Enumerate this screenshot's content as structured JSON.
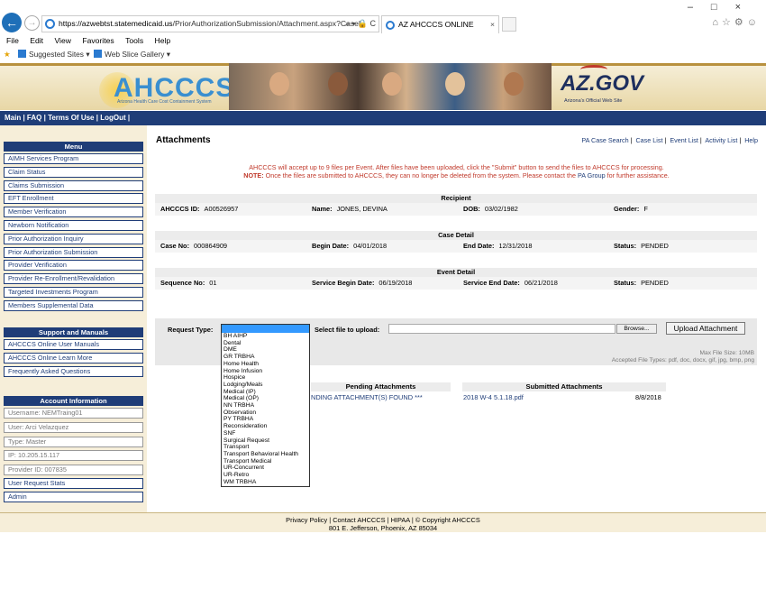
{
  "browser": {
    "url_host": "https://azwebtst.statemedicaid.us",
    "url_path": "/PriorAuthorizationSubmission/Attachment.aspx?Casel",
    "url_tools": "⌕ ▾ 🔒 C",
    "tab_title": "AZ AHCCCS ONLINE",
    "tab_close": "×",
    "window_controls": "–□×",
    "right_icons": "⌂☆⚙☺",
    "menu": [
      "File",
      "Edit",
      "View",
      "Favorites",
      "Tools",
      "Help"
    ],
    "favorites": {
      "suggested": "Suggested Sites ▾",
      "gallery": "Web Slice Gallery ▾"
    }
  },
  "banner": {
    "logo": "AHCCCS",
    "logo_sub": "Arizona Health Care Cost Containment System",
    "azgov": "AZ.GOV",
    "azgov_sub": "Arizona's Official Web Site"
  },
  "topnav": [
    "Main",
    "FAQ",
    "Terms Of Use",
    "LogOut"
  ],
  "sidebar": {
    "menu_title": "Menu",
    "menu_items": [
      "AIMH Services Program",
      "Claim Status",
      "Claims Submission",
      "EFT Enrollment",
      "Member Verification",
      "Newborn Notification",
      "Prior Authorization Inquiry",
      "Prior Authorization Submission",
      "Provider Verification",
      "Provider Re-Enrollment/Revalidation",
      "Targeted Investments Program",
      "Members Supplemental Data"
    ],
    "support_title": "Support and Manuals",
    "support_items": [
      "AHCCCS Online User Manuals",
      "AHCCCS Online Learn More",
      "Frequently Asked Questions"
    ],
    "account_title": "Account Information",
    "account_items": [
      "Username: NEMTraing01",
      "User: Arci Velazquez",
      "Type: Master",
      "IP: 10.205.15.117",
      "Provider ID: 007835"
    ],
    "account_links": [
      "User Request Stats",
      "Admin"
    ]
  },
  "page": {
    "title": "Attachments",
    "links": [
      "PA Case Search",
      "Case List",
      "Event List",
      "Activity List",
      "Help"
    ],
    "notice_line1": "AHCCCS will accept up to 9 files per Event. After files have been uploaded, click the \"Submit\" button to send the files to AHCCCS for processing.",
    "notice_line2_label": "NOTE:",
    "notice_line2": " Once the files are submitted to AHCCCS, they can no longer be deleted from the system. Please contact the ",
    "notice_link": "PA Group",
    "notice_line2_end": " for further assistance."
  },
  "recipient": {
    "title": "Recipient",
    "id_label": "AHCCCS ID:",
    "id": "A00526957",
    "name_label": "Name:",
    "name": "JONES, DEVINA",
    "dob_label": "DOB:",
    "dob": "03/02/1982",
    "gender_label": "Gender:",
    "gender": "F"
  },
  "case": {
    "title": "Case Detail",
    "no_label": "Case No:",
    "no": "000864909",
    "begin_label": "Begin Date:",
    "begin": "04/01/2018",
    "end_label": "End Date:",
    "end": "12/31/2018",
    "status_label": "Status:",
    "status": "PENDED"
  },
  "event": {
    "title": "Event Detail",
    "seq_label": "Sequence No:",
    "seq": "01",
    "sbegin_label": "Service Begin Date:",
    "sbegin": "06/19/2018",
    "send_label": "Service End Date:",
    "send": "06/21/2018",
    "status_label": "Status:",
    "status": "PENDED"
  },
  "upload": {
    "request_type_label": "Request Type:",
    "select_file_label": "Select file to upload:",
    "browse": "Browse...",
    "upload_button": "Upload Attachment",
    "max_size": "Max File Size: 10MB",
    "file_types": "Accepted File Types: pdf, doc, docx, gif, jpg, bmp, png"
  },
  "attachments": {
    "pending_title": "Pending Attachments",
    "pending_text": "NDING ATTACHMENT(S) FOUND ***",
    "submitted_title": "Submitted Attachments",
    "submitted_file": "2018 W-4 5.1.18.pdf",
    "submitted_date": "8/8/2018"
  },
  "request_type_options": [
    "BH AIHP",
    "Dental",
    "DME",
    "GR TRBHA",
    "Home Health",
    "Home Infusion",
    "Hospice",
    "Lodging/Meals",
    "Medical (IP)",
    "Medical (OP)",
    "NN TRBHA",
    "Observation",
    "PY TRBHA",
    "Reconsideration",
    "SNF",
    "Surgical Request",
    "Transport",
    "Transport Behavioral Health",
    "Transport Medical",
    "UR-Concurrent",
    "UR-Retro",
    "WM TRBHA"
  ],
  "footer": {
    "links": [
      "Privacy Policy",
      "Contact AHCCCS",
      "HIPAA",
      "© Copyright AHCCCS"
    ],
    "address": "801 E. Jefferson, Phoenix, AZ 85034"
  },
  "colors": {
    "navy": "#1f3d78",
    "red": "#c0392b",
    "tan": "#f6eed9",
    "highlight": "#3399ff"
  }
}
